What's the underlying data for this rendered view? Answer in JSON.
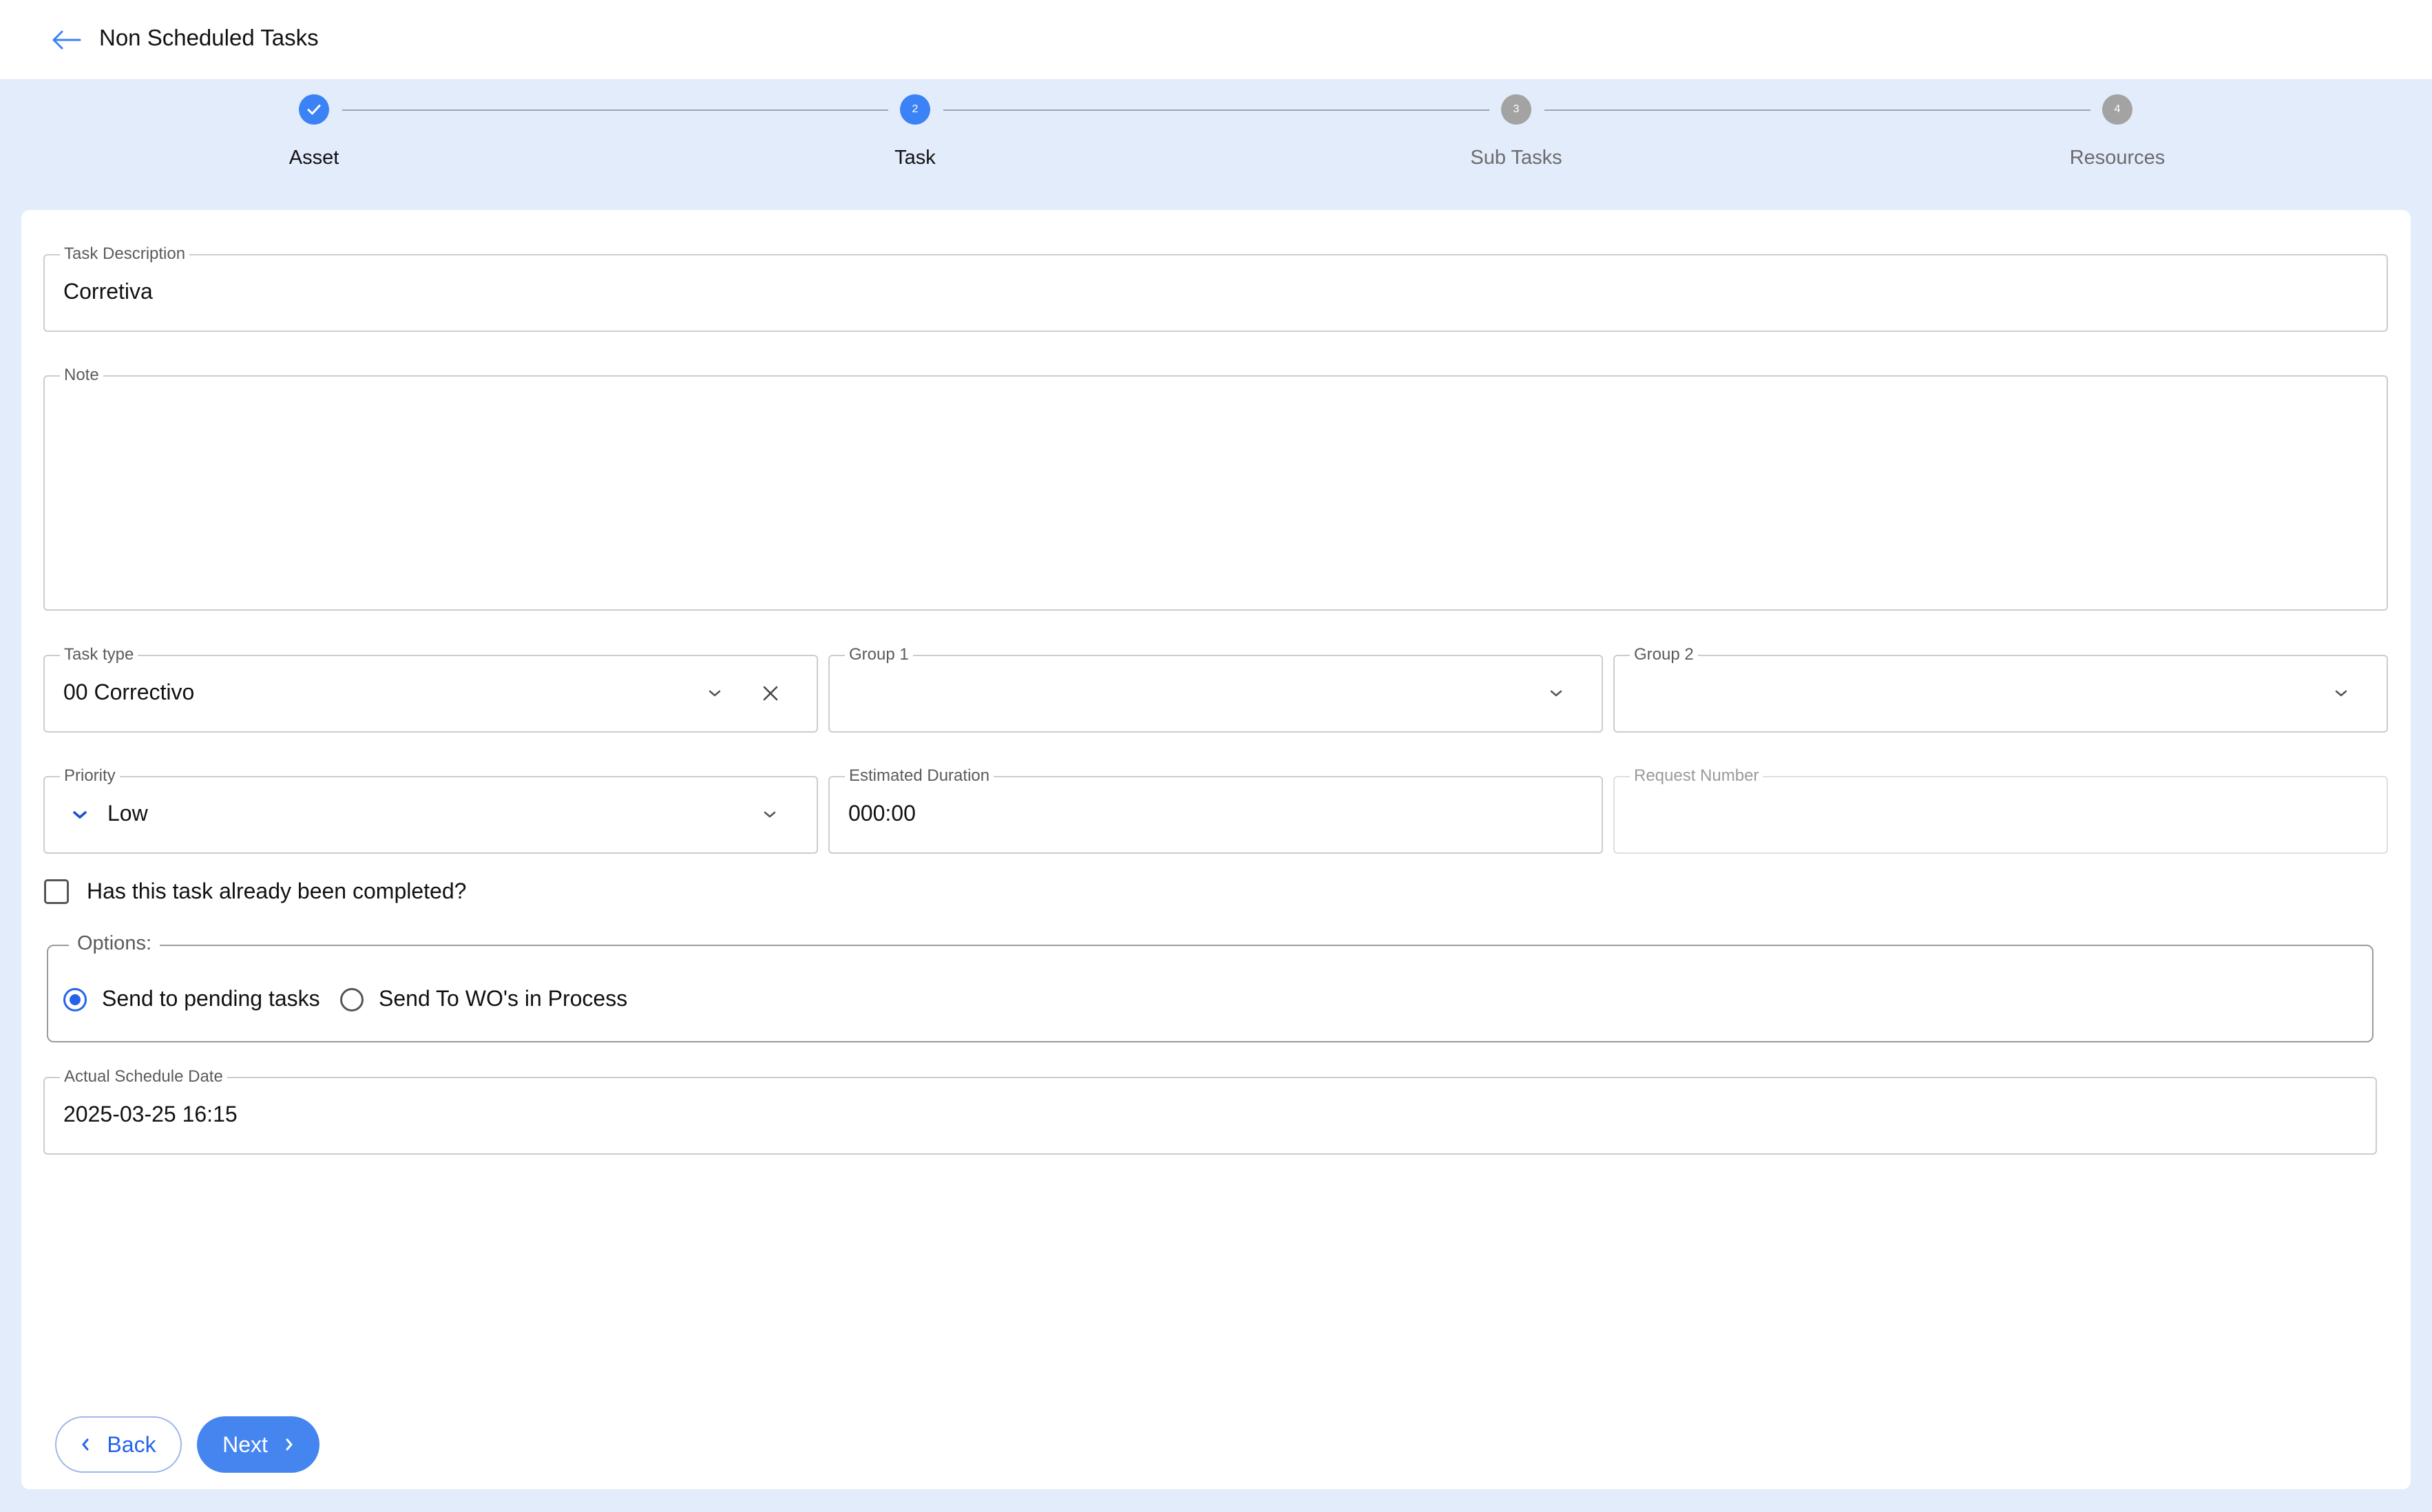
{
  "header": {
    "title": "Non Scheduled Tasks",
    "back_icon": "arrow-left-icon"
  },
  "stepper": {
    "steps": [
      {
        "label": "Asset",
        "number": "1",
        "state": "done"
      },
      {
        "label": "Task",
        "number": "2",
        "state": "active"
      },
      {
        "label": "Sub Tasks",
        "number": "3",
        "state": "pending"
      },
      {
        "label": "Resources",
        "number": "4",
        "state": "pending"
      }
    ]
  },
  "form": {
    "task_description": {
      "label": "Task Description",
      "value": "Corretiva"
    },
    "note": {
      "label": "Note",
      "value": ""
    },
    "task_type": {
      "label": "Task type",
      "value": "00 Correctivo"
    },
    "group1": {
      "label": "Group 1",
      "value": ""
    },
    "group2": {
      "label": "Group 2",
      "value": ""
    },
    "priority": {
      "label": "Priority",
      "value": "Low"
    },
    "estimated_duration": {
      "label": "Estimated Duration",
      "value": "000:00"
    },
    "request_number": {
      "label": "Request Number",
      "value": ""
    },
    "completed_checkbox": {
      "label": "Has this task already been completed?",
      "checked": false
    },
    "options": {
      "legend": "Options:",
      "choices": [
        {
          "label": "Send to pending tasks",
          "selected": true
        },
        {
          "label": "Send To WO's in Process",
          "selected": false
        }
      ]
    },
    "actual_schedule_date": {
      "label": "Actual Schedule Date",
      "value": "2025-03-25 16:15"
    }
  },
  "footer": {
    "back_label": "Back",
    "next_label": "Next"
  },
  "colors": {
    "accent": "#3b82f6",
    "background": "#e3ecfb",
    "pending_step": "#a3a3a3"
  }
}
